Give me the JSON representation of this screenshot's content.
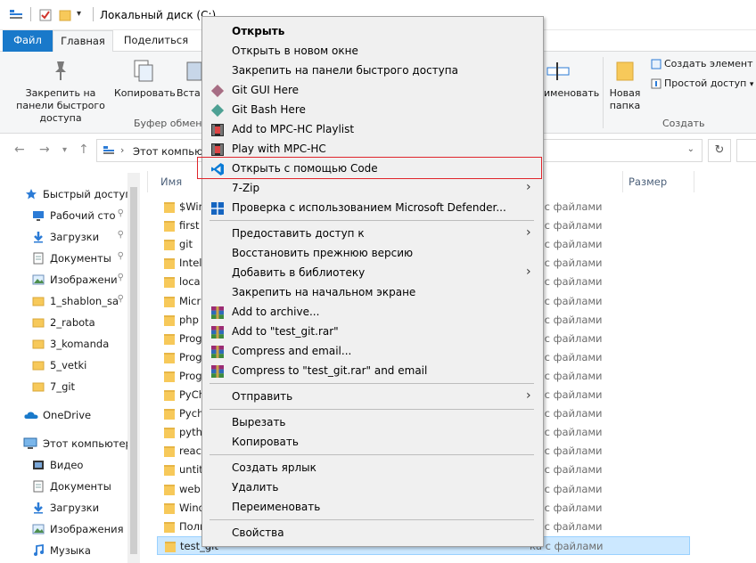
{
  "window": {
    "title": "Локальный диск (C:)"
  },
  "ribbon": {
    "tabs": {
      "file": "Файл",
      "home": "Главная",
      "share": "Поделиться"
    },
    "pin_label": "Закрепить на панели быстрого доступа",
    "copy_label": "Копировать",
    "paste_label": "Вста",
    "clipboard_group": "Буфер обмена",
    "rename_label": "именовать",
    "new_folder_label": "Новая папка",
    "new_item_label": "Создать элемент",
    "easy_access_label": "Простой доступ",
    "create_group": "Создать"
  },
  "address": {
    "path": "Этот компьют"
  },
  "navpane": {
    "quick_access": "Быстрый доступ",
    "items": [
      {
        "label": "Рабочий сто",
        "icon": "desktop-icon",
        "pinned": true
      },
      {
        "label": "Загрузки",
        "icon": "downloads-icon",
        "pinned": true
      },
      {
        "label": "Документы",
        "icon": "documents-icon",
        "pinned": true
      },
      {
        "label": "Изображени",
        "icon": "pictures-icon",
        "pinned": true
      },
      {
        "label": "1_shablon_sa",
        "icon": "folder-icon",
        "pinned": true
      },
      {
        "label": "2_rabota",
        "icon": "folder-icon",
        "pinned": false
      },
      {
        "label": "3_komanda",
        "icon": "folder-icon",
        "pinned": false
      },
      {
        "label": "5_vetki",
        "icon": "folder-icon",
        "pinned": false
      },
      {
        "label": "7_git",
        "icon": "folder-icon",
        "pinned": false
      }
    ],
    "onedrive": "OneDrive",
    "this_pc": "Этот компьютер",
    "pc_items": [
      {
        "label": "Видео",
        "icon": "video-icon"
      },
      {
        "label": "Документы",
        "icon": "documents-icon"
      },
      {
        "label": "Загрузки",
        "icon": "downloads-icon"
      },
      {
        "label": "Изображения",
        "icon": "pictures-icon"
      },
      {
        "label": "Музыка",
        "icon": "music-icon"
      }
    ],
    "pin_glyph": "📌"
  },
  "filelist": {
    "headers": {
      "name": "Имя",
      "size": "Размер"
    },
    "type_label": "ка с файлами",
    "rows": [
      {
        "name": "$Win",
        "type": "ка с файлами"
      },
      {
        "name": "first",
        "type": "ка с файлами"
      },
      {
        "name": "git",
        "type": "ка с файлами"
      },
      {
        "name": "Intel",
        "type": "ка с файлами"
      },
      {
        "name": "loca",
        "type": "ка с файлами"
      },
      {
        "name": "Micr",
        "type": "ка с файлами"
      },
      {
        "name": "php",
        "type": "ка с файлами"
      },
      {
        "name": "Prog",
        "type": "ка с файлами"
      },
      {
        "name": "Prog",
        "type": "ка с файлами"
      },
      {
        "name": "Prog",
        "type": "ка с файлами"
      },
      {
        "name": "PyCh",
        "type": "ка с файлами"
      },
      {
        "name": "Pych",
        "type": "ка с файлами"
      },
      {
        "name": "pyth",
        "type": "ка с файлами"
      },
      {
        "name": "react",
        "type": "ка с файлами"
      },
      {
        "name": "untit",
        "type": "ка с файлами"
      },
      {
        "name": "web",
        "type": "ка с файлами"
      },
      {
        "name": "Wind",
        "type": "ка с файлами"
      },
      {
        "name": "Поль",
        "type": "ка с файлами"
      },
      {
        "name": "test_git",
        "type": "ка с файлами",
        "selected": true
      }
    ]
  },
  "context_menu": {
    "items": [
      {
        "label": "Открыть",
        "bold": true,
        "icon": ""
      },
      {
        "label": "Открыть в новом окне",
        "icon": ""
      },
      {
        "label": "Закрепить на панели быстрого доступа",
        "icon": ""
      },
      {
        "label": "Git GUI Here",
        "icon": "git-gui-icon"
      },
      {
        "label": "Git Bash Here",
        "icon": "git-bash-icon"
      },
      {
        "label": "Add to MPC-HC Playlist",
        "icon": "mpc-hc-icon"
      },
      {
        "label": "Play with MPC-HC",
        "icon": "mpc-hc-icon"
      },
      {
        "label": "Открыть с помощью Code",
        "icon": "vscode-icon",
        "highlighted": true
      },
      {
        "label": "7-Zip",
        "icon": "",
        "submenu": true
      },
      {
        "label": "Проверка с использованием Microsoft Defender...",
        "icon": "defender-icon"
      },
      {
        "separator": true
      },
      {
        "label": "Предоставить доступ к",
        "icon": "",
        "submenu": true
      },
      {
        "label": "Восстановить прежнюю версию",
        "icon": ""
      },
      {
        "label": "Добавить в библиотеку",
        "icon": "",
        "submenu": true
      },
      {
        "label": "Закрепить на начальном экране",
        "icon": ""
      },
      {
        "label": "Add to archive...",
        "icon": "winrar-icon"
      },
      {
        "label": "Add to \"test_git.rar\"",
        "icon": "winrar-icon"
      },
      {
        "label": "Compress and email...",
        "icon": "winrar-icon"
      },
      {
        "label": "Compress to \"test_git.rar\" and email",
        "icon": "winrar-icon"
      },
      {
        "separator": true
      },
      {
        "label": "Отправить",
        "icon": "",
        "submenu": true
      },
      {
        "separator": true
      },
      {
        "label": "Вырезать",
        "icon": ""
      },
      {
        "label": "Копировать",
        "icon": ""
      },
      {
        "separator": true
      },
      {
        "label": "Создать ярлык",
        "icon": ""
      },
      {
        "label": "Удалить",
        "icon": ""
      },
      {
        "label": "Переименовать",
        "icon": ""
      },
      {
        "separator": true
      },
      {
        "label": "Свойства",
        "icon": ""
      }
    ]
  },
  "colors": {
    "accent": "#1979ca",
    "selection": "#cce8ff",
    "highlight_border": "#e0252b",
    "folder": "#f7c95a"
  }
}
